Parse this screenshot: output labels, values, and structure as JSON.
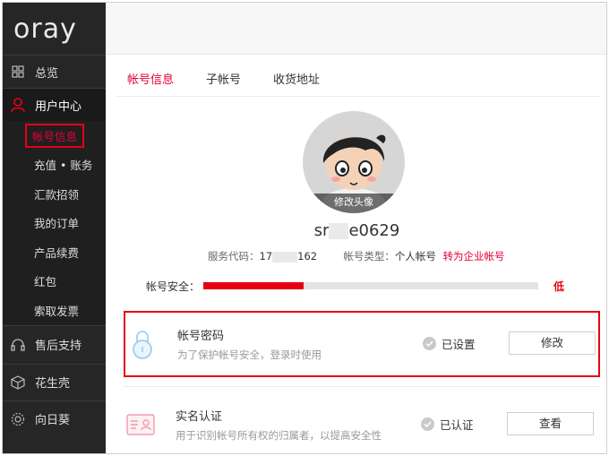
{
  "brand": {
    "logo_text": "oray"
  },
  "sidebar": {
    "overview": "总览",
    "user_center": "用户中心",
    "sub_items": [
      "帐号信息",
      "充值 • 账务",
      "汇款招领",
      "我的订单",
      "产品续费",
      "红包",
      "索取发票"
    ],
    "after_sales": "售后支持",
    "peanut_shell": "花生壳",
    "sunflower": "向日葵"
  },
  "tabs": [
    "帐号信息",
    "子帐号",
    "收货地址"
  ],
  "profile": {
    "avatar_caption": "修改头像",
    "username_start": "sr",
    "username_end": "e0629",
    "service_code_label": "服务代码：",
    "service_code_start": "17",
    "service_code_end": "162",
    "account_type_label": "帐号类型：",
    "account_type_value": "个人帐号",
    "convert_link": "转为企业帐号"
  },
  "security": {
    "label": "帐号安全：",
    "level_text": "低",
    "level_fraction": 0.3
  },
  "cards": [
    {
      "title": "帐号密码",
      "desc": "为了保护帐号安全，登录时使用",
      "status": "已设置",
      "button": "修改"
    },
    {
      "title": "实名认证",
      "desc": "用于识别帐号所有权的归属者，以提高安全性",
      "status": "已认证",
      "button": "查看"
    }
  ],
  "colors": {
    "accent": "#e4003a",
    "sidebar_bg": "#262626",
    "security_fill": "#e60012"
  }
}
